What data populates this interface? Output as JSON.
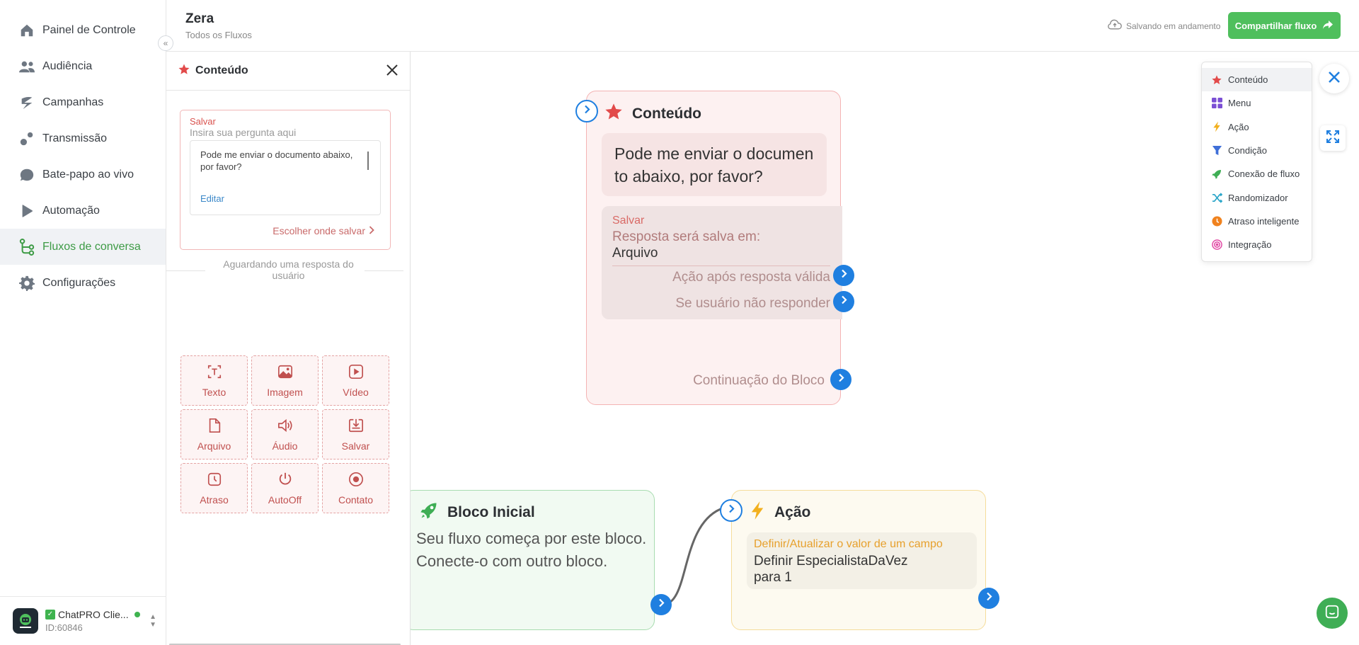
{
  "sidebar": {
    "items": [
      {
        "label": "Painel de Controle",
        "icon": "home-icon"
      },
      {
        "label": "Audiência",
        "icon": "users-icon"
      },
      {
        "label": "Campanhas",
        "icon": "campaign-icon"
      },
      {
        "label": "Transmissão",
        "icon": "broadcast-icon"
      },
      {
        "label": "Bate-papo ao vivo",
        "icon": "chat-bubble-icon"
      },
      {
        "label": "Automação",
        "icon": "play-icon"
      },
      {
        "label": "Fluxos de conversa",
        "icon": "flow-icon"
      },
      {
        "label": "Configurações",
        "icon": "gear-icon"
      }
    ],
    "active_index": 6,
    "user": {
      "name": "ChatPRO Clie...",
      "id": "ID:60846"
    }
  },
  "header": {
    "flow_name": "Zera",
    "breadcrumb": "Todos os Fluxos",
    "saving_status": "Salvando em andamento",
    "share_label": "Compartilhar fluxo"
  },
  "editor": {
    "title": "Conteúdo",
    "save_title": "Salvar",
    "question_placeholder": "Insira sua pergunta aqui",
    "message": "Pode me enviar o documento abaixo, por favor?",
    "edit_label": "Editar",
    "choose_save_label": "Escolher onde salvar",
    "awaiting_label": "Aguardando uma resposta do usuário",
    "tools": [
      {
        "label": "Texto",
        "icon": "text-icon"
      },
      {
        "label": "Imagem",
        "icon": "image-icon"
      },
      {
        "label": "Vídeo",
        "icon": "video-icon"
      },
      {
        "label": "Arquivo",
        "icon": "file-icon"
      },
      {
        "label": "Áudio",
        "icon": "audio-icon"
      },
      {
        "label": "Salvar",
        "icon": "save-icon"
      },
      {
        "label": "Atraso",
        "icon": "delay-icon"
      },
      {
        "label": "AutoOff",
        "icon": "power-icon"
      },
      {
        "label": "Contato",
        "icon": "contact-icon"
      }
    ]
  },
  "canvas": {
    "content_node": {
      "title": "Conteúdo",
      "message_line1": "Pode me enviar o documen",
      "message_line2": "to abaixo, por favor?",
      "save_title": "Salvar",
      "save_desc": "Resposta será salva em:",
      "save_target": "Arquivo",
      "valid_action": "Ação após resposta válida",
      "no_reply": "Se usuário não responder",
      "continuation": "Continuação do Bloco"
    },
    "start_node": {
      "title": "Bloco Inicial",
      "desc_line1": "Seu fluxo começa por este bloco.",
      "desc_line2": "Conecte-o com outro bloco."
    },
    "action_node": {
      "title": "Ação",
      "sec_title": "Definir/Atualizar o valor de um campo",
      "sec_line1": "Definir EspecialistaDaVez",
      "sec_line2": "para 1"
    },
    "block_menu": [
      {
        "label": "Conteúdo",
        "icon": "star-icon",
        "color": "#e24a4a"
      },
      {
        "label": "Menu",
        "icon": "grid-icon",
        "color": "#7b4fd4"
      },
      {
        "label": "Ação",
        "icon": "bolt-icon",
        "color": "#f2b01e"
      },
      {
        "label": "Condição",
        "icon": "funnel-icon",
        "color": "#3f6fd8"
      },
      {
        "label": "Conexão de fluxo",
        "icon": "rocket-icon",
        "color": "#3fae55"
      },
      {
        "label": "Randomizador",
        "icon": "shuffle-icon",
        "color": "#2ba6c9"
      },
      {
        "label": "Atraso inteligente",
        "icon": "clock-icon",
        "color": "#f0821e"
      },
      {
        "label": "Integração",
        "icon": "integration-icon",
        "color": "#e24aa5"
      }
    ]
  },
  "colors": {
    "accent": "#4fbf5d",
    "connector": "#1f7fe0",
    "content": "#e24a4a"
  }
}
